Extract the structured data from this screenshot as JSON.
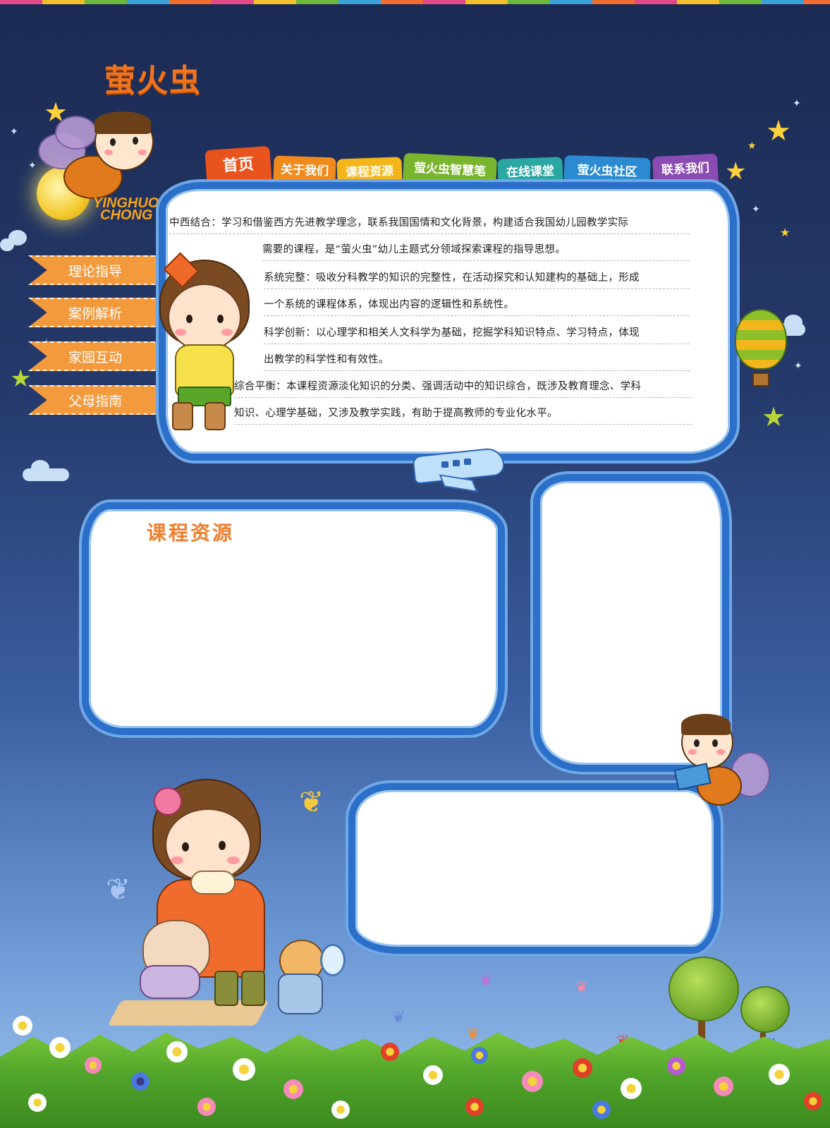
{
  "brand": {
    "name_cn": "萤火虫",
    "name_en_line1": "YINGHUO",
    "name_en_line2": "CHONG"
  },
  "nav": {
    "tabs": [
      {
        "label": "首页",
        "color": "#e8531e"
      },
      {
        "label": "关于我们",
        "color": "#f08a1c"
      },
      {
        "label": "课程资源",
        "color": "#f3b51a"
      },
      {
        "label": "萤火虫智慧笔",
        "color": "#7ab52e"
      },
      {
        "label": "在线课堂",
        "color": "#2aa7a2"
      },
      {
        "label": "萤火虫社区",
        "color": "#2b8ad2"
      },
      {
        "label": "联系我们",
        "color": "#8a4bb3"
      }
    ]
  },
  "sidebar": {
    "items": [
      {
        "label": "理论指导"
      },
      {
        "label": "案例解析"
      },
      {
        "label": "家园互动"
      },
      {
        "label": "父母指南"
      }
    ]
  },
  "intro": {
    "lines": [
      "中西结合：学习和借鉴西方先进教学理念，联系我国国情和文化背景，构建适合我国幼儿园教学实际",
      "需要的课程，是“萤火虫”幼儿主题式分领域探索课程的指导思想。",
      "系统完整：吸收分科教学的知识的完整性，在活动探究和认知建构的基础上，形成",
      "一个系统的课程体系，体现出内容的逻辑性和系统性。",
      "科学创新：以心理学和相关人文科学为基础，挖掘学科知识特点、学习特点，体现",
      "出教学的科学性和有效性。",
      "综合平衡：本课程资源淡化知识的分类、强调活动中的知识综合，既涉及教育理念、学科",
      "知识、心理学基础，又涉及教学实践，有助于提高教师的专业化水平。"
    ]
  },
  "course": {
    "title": "课程资源"
  },
  "icons": [
    "star-icon",
    "cloud-icon",
    "airplane-icon",
    "hot-air-balloon-icon",
    "butterfly-icon",
    "flower-icon",
    "tree-icon"
  ],
  "colors": {
    "accent_orange": "#f07d2a",
    "panel_border": "#2c6fc9",
    "sky_top": "#1b2a52",
    "sky_bottom": "#9cc4ee"
  }
}
